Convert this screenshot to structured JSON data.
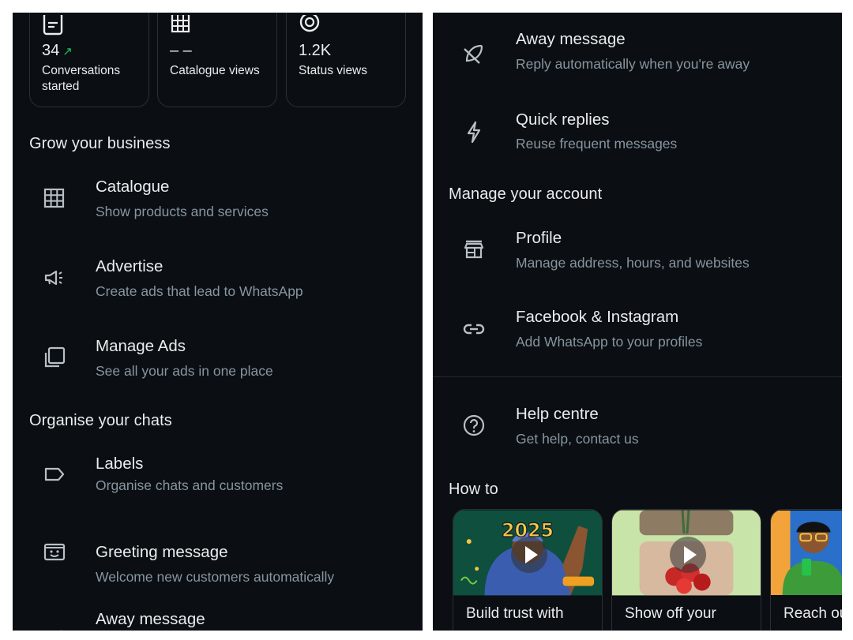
{
  "left": {
    "stats": [
      {
        "icon": "document-icon",
        "value": "34",
        "trend": "↗",
        "label": "Conversations started"
      },
      {
        "icon": "grid-icon",
        "value": "– –",
        "trend": "",
        "label": "Catalogue views"
      },
      {
        "icon": "status-icon",
        "value": "1.2K",
        "trend": "",
        "label": "Status views"
      }
    ],
    "grow_title": "Grow your business",
    "grow_items": [
      {
        "title": "Catalogue",
        "subtitle": "Show products and services",
        "icon": "catalogue-icon"
      },
      {
        "title": "Advertise",
        "subtitle": "Create ads that lead to WhatsApp",
        "icon": "megaphone-icon"
      },
      {
        "title": "Manage Ads",
        "subtitle": "See all your ads in one place",
        "icon": "manage-ads-icon"
      }
    ],
    "organise_title": "Organise your chats",
    "organise_items": [
      {
        "title": "Labels",
        "subtitle": "Organise chats and customers",
        "icon": "label-icon"
      },
      {
        "title": "Greeting message",
        "subtitle": "Welcome new customers automatically",
        "icon": "greeting-icon"
      },
      {
        "title": "Away message",
        "subtitle": "",
        "icon": "away-icon"
      }
    ]
  },
  "right": {
    "top_items": [
      {
        "title": "Away message",
        "subtitle": "Reply automatically when you're away",
        "icon": "away-icon"
      },
      {
        "title": "Quick replies",
        "subtitle": "Reuse frequent messages",
        "icon": "lightning-icon"
      }
    ],
    "account_title": "Manage your account",
    "account_items": [
      {
        "title": "Profile",
        "subtitle": "Manage address, hours, and websites",
        "icon": "store-icon"
      },
      {
        "title": "Facebook & Instagram",
        "subtitle": "Add WhatsApp to your profiles",
        "icon": "link-icon"
      }
    ],
    "help": {
      "title": "Help centre",
      "subtitle": "Get help, contact us",
      "icon": "help-icon"
    },
    "howto_title": "How to",
    "videos": [
      {
        "caption": "Build trust with",
        "badge": "2025"
      },
      {
        "caption": "Show off your"
      },
      {
        "caption": "Reach ou"
      }
    ]
  },
  "colors": {
    "background": "#0b0e12",
    "text": "#e9edef",
    "subtext": "#8696a0",
    "accent": "#21c063"
  }
}
